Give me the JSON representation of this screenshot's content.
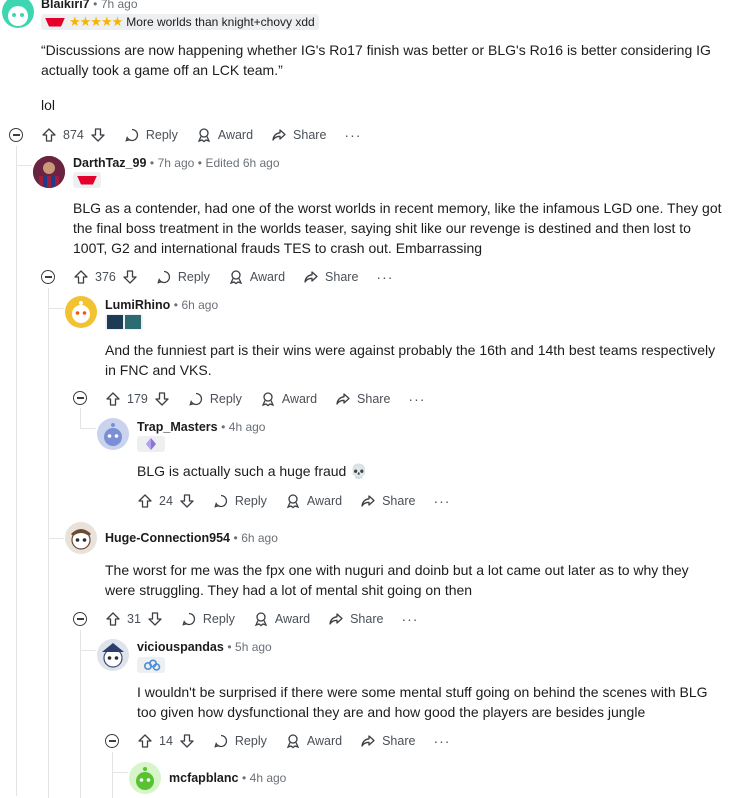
{
  "comments": [
    {
      "id": "blaikiri7",
      "username": "Blaikiri7",
      "time": "7h ago",
      "flair": "More worlds than knight+chovy xdd",
      "body_lines": [
        "“Discussions are now happening whether IG's Ro17 finish was better or BLG's Ro16 is better considering IG",
        "actually took a game off an LCK team.”"
      ],
      "body_extra": "lol",
      "votes": "874"
    },
    {
      "id": "darthtaz",
      "username": "DarthTaz_99",
      "time": "7h ago",
      "edited": "Edited 6h ago",
      "body_lines": [
        "BLG as a contender, had one of the worst worlds in recent memory, like the infamous LGD one. They got",
        "the final boss treatment in the worlds teaser, saying shit like our revenge is destined and then lost to",
        "100T, G2 and international frauds TES to crash out. Embarrassing"
      ],
      "votes": "376"
    },
    {
      "id": "lumirhino",
      "username": "LumiRhino",
      "time": "6h ago",
      "body_lines": [
        "And the funniest part is their wins were against probably the 16th and 14th best teams respectively",
        "in FNC and VKS."
      ],
      "votes": "179"
    },
    {
      "id": "trapmasters",
      "username": "Trap_Masters",
      "time": "4h ago",
      "body_lines": [
        "BLG is actually such a huge fraud 💀"
      ],
      "votes": "24"
    },
    {
      "id": "hugeconnection",
      "username": "Huge-Connection954",
      "time": "6h ago",
      "body_lines": [
        "The worst for me was the fpx one with nuguri and doinb but a lot came out later as to why they",
        "were struggling. They had a lot of mental shit going on then"
      ],
      "votes": "31"
    },
    {
      "id": "viciouspandas",
      "username": "viciouspandas",
      "time": "5h ago",
      "body_lines": [
        "I wouldn't be surprised if there were some mental stuff going on behind the scenes with BLG",
        "too given how dysfunctional they are and how good the players are besides jungle"
      ],
      "votes": "14"
    },
    {
      "id": "mcfapblanc",
      "username": "mcfapblanc",
      "time": "4h ago"
    }
  ],
  "labels": {
    "reply": "Reply",
    "award": "Award",
    "share": "Share",
    "more": "···",
    "separator": "•"
  },
  "colors": {
    "accent": "#d93a00",
    "line": "#e2e4e6",
    "meta": "#6b7178"
  },
  "icons": [
    "upvote-icon",
    "downvote-icon",
    "reply-icon",
    "award-icon",
    "share-icon",
    "collapse-icon",
    "star-icon",
    "diamond-icon",
    "cloud-icon"
  ]
}
